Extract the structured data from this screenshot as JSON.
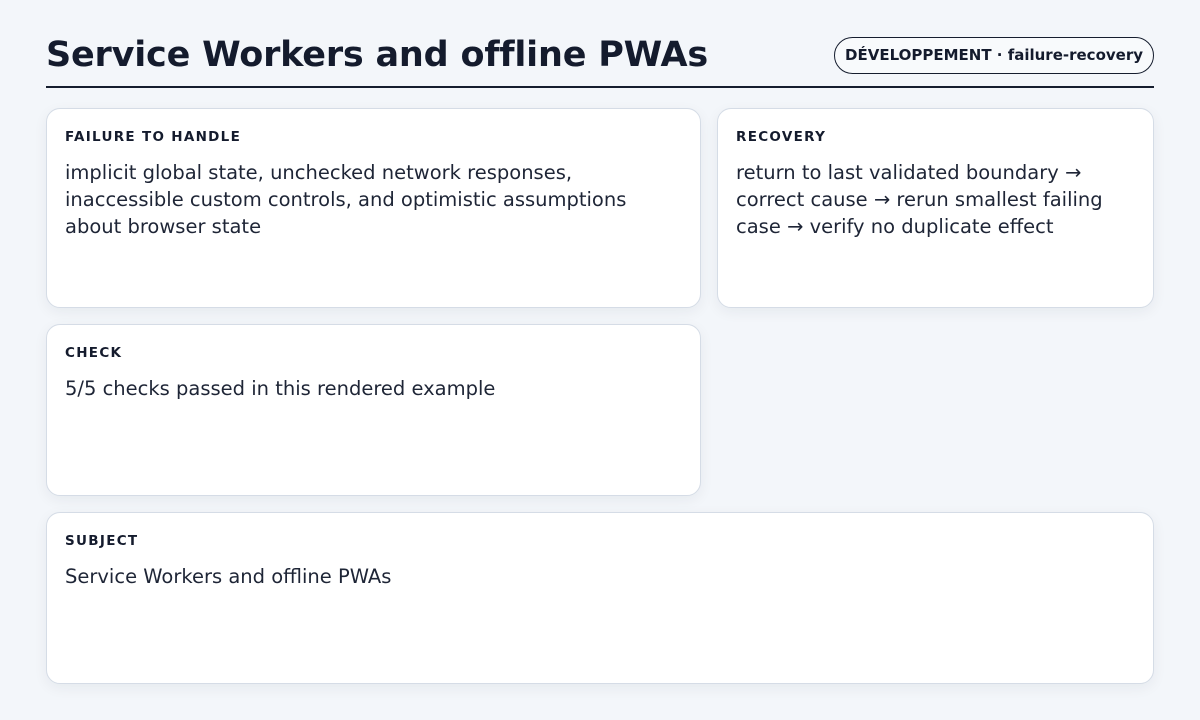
{
  "header": {
    "title": "Service Workers and offline PWAs",
    "badge": "DÉVELOPPEMENT · failure-recovery"
  },
  "cards": {
    "failure": {
      "label": "FAILURE TO HANDLE",
      "text": "implicit global state, unchecked network responses, inaccessible custom controls, and optimistic assumptions about browser state"
    },
    "recovery": {
      "label": "RECOVERY",
      "text": "return to last validated boundary → correct cause → rerun smallest failing case → verify no duplicate effect"
    },
    "check": {
      "label": "CHECK",
      "text": "5/5 checks passed in this rendered example"
    },
    "subject": {
      "label": "SUBJECT",
      "text": "Service Workers and offline PWAs"
    }
  }
}
